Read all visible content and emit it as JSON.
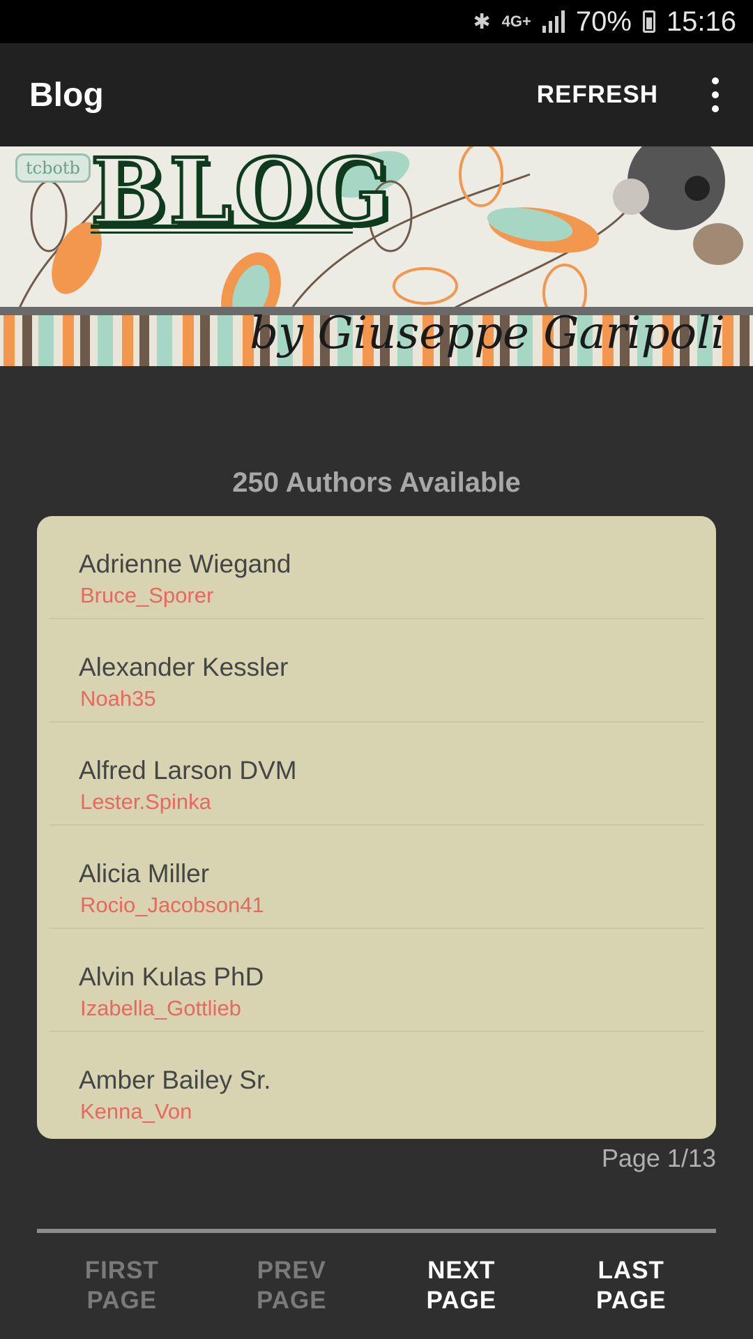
{
  "status_bar": {
    "bluetooth_icon": "bluetooth-icon",
    "network_type": "4G+",
    "signal_icon": "signal-icon",
    "battery_percent": "70%",
    "battery_icon": "battery-charging-icon",
    "time": "15:16"
  },
  "app_bar": {
    "title": "Blog",
    "refresh_label": "REFRESH",
    "menu_icon": "more-vert-icon"
  },
  "banner": {
    "tag": "tcbotb",
    "title": "BLOG",
    "byline": "by Giuseppe Garipoli"
  },
  "header": {
    "authors_count": "250 Authors Available"
  },
  "authors": [
    {
      "name": "Adrienne Wiegand",
      "username": "Bruce_Sporer"
    },
    {
      "name": "Alexander Kessler",
      "username": "Noah35"
    },
    {
      "name": "Alfred Larson DVM",
      "username": "Lester.Spinka"
    },
    {
      "name": "Alicia Miller",
      "username": "Rocio_Jacobson41"
    },
    {
      "name": "Alvin Kulas PhD",
      "username": "Izabella_Gottlieb"
    },
    {
      "name": "Amber Bailey Sr.",
      "username": "Kenna_Von"
    }
  ],
  "pagination": {
    "page_indicator": "Page 1/13",
    "first_label": "FIRST\nPAGE",
    "prev_label": "PREV\nPAGE",
    "next_label": "NEXT\nPAGE",
    "last_label": "LAST\nPAGE"
  },
  "colors": {
    "background": "#2f2f2f",
    "app_bar": "#212121",
    "card": "#d8d4b2",
    "username": "#e8675f"
  }
}
